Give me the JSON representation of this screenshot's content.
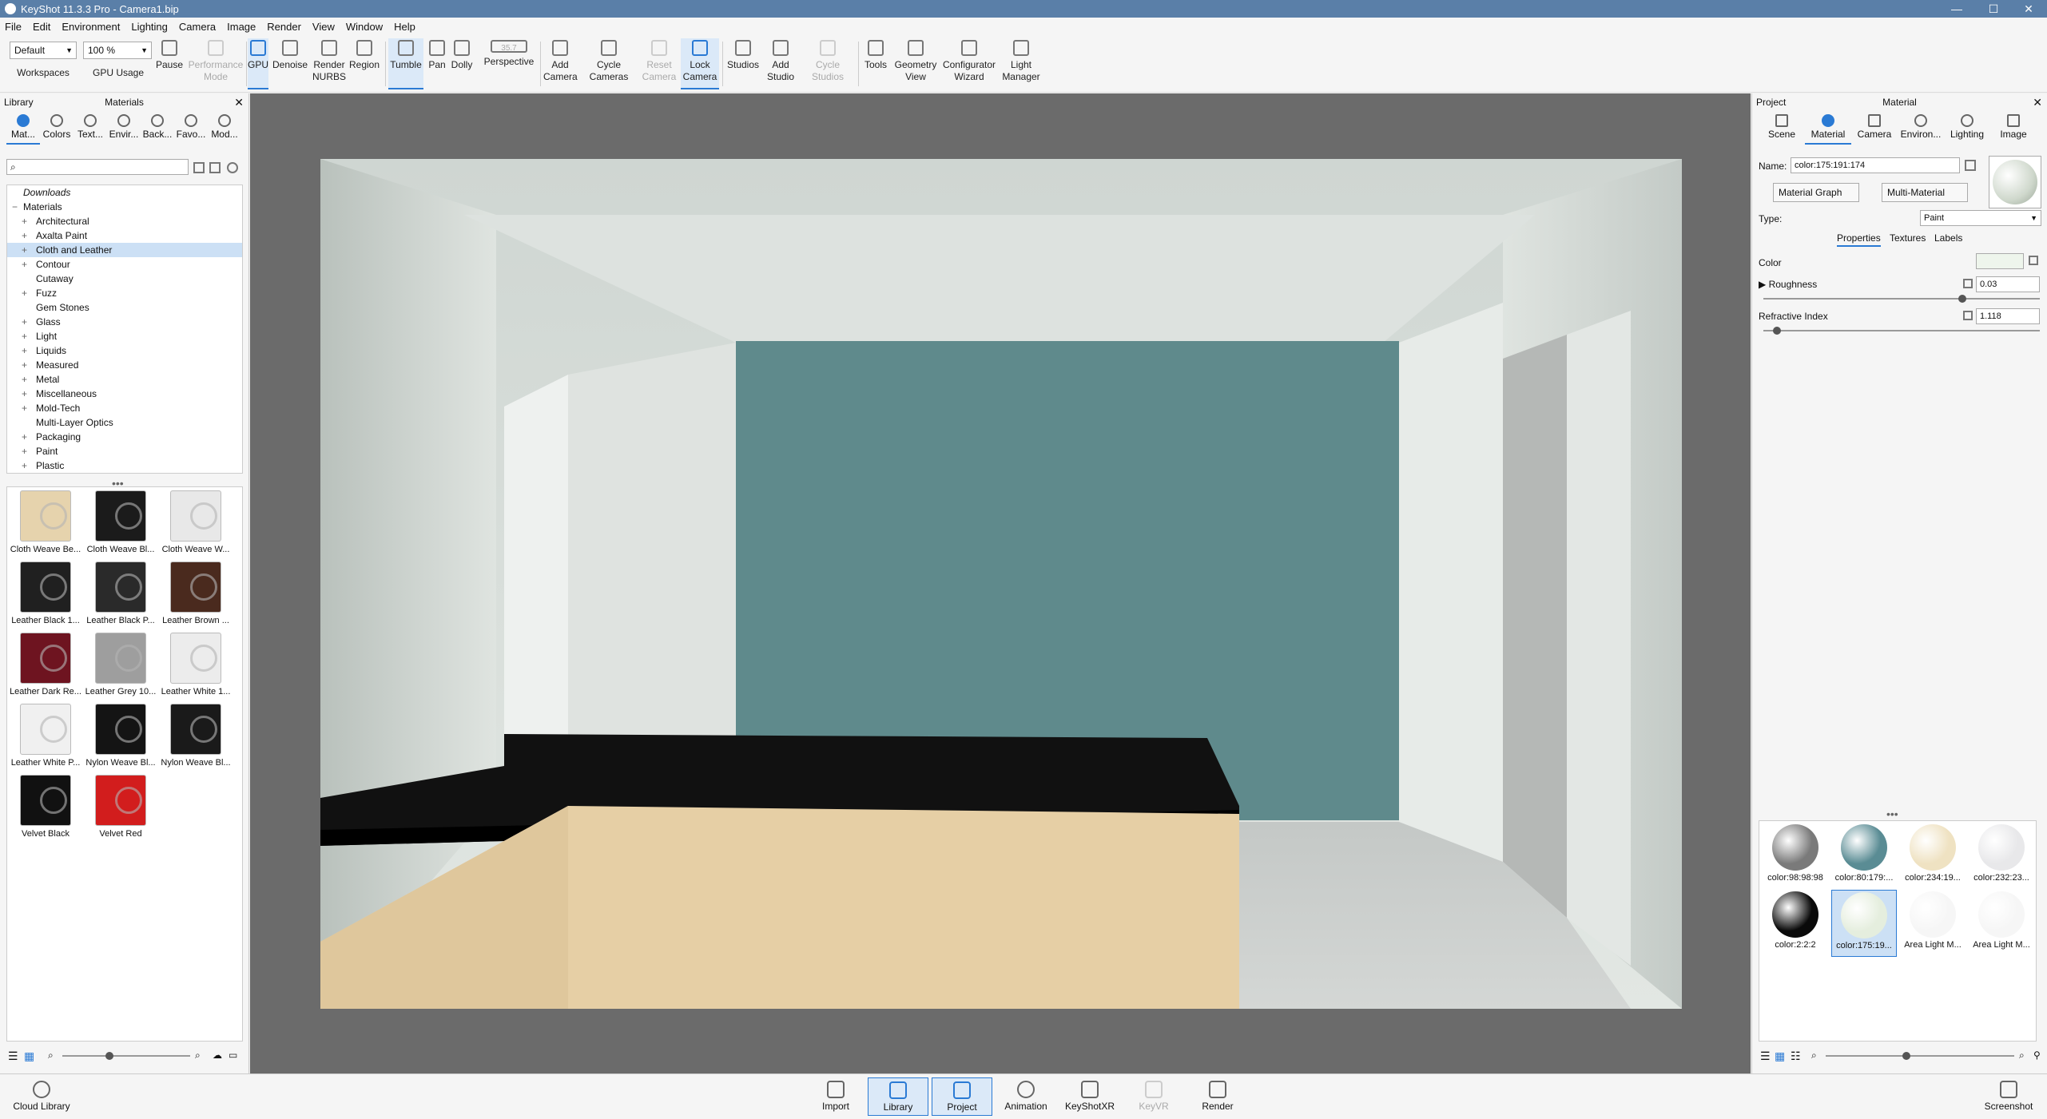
{
  "window": {
    "title": "KeyShot 11.3.3 Pro  - Camera1.bip",
    "min": "—",
    "max": "☐",
    "close": "✕"
  },
  "menu": [
    "File",
    "Edit",
    "Environment",
    "Lighting",
    "Camera",
    "Image",
    "Render",
    "View",
    "Window",
    "Help"
  ],
  "toolbar": {
    "workspace_select": "Default",
    "zoom_select": "100 %",
    "focal": "35.7",
    "workspaces": "Workspaces",
    "gpu_usage": "GPU Usage",
    "pause": "Pause",
    "performance_mode": "Performance Mode",
    "gpu": "GPU",
    "denoise": "Denoise",
    "render_nurbs": "Render NURBS",
    "region": "Region",
    "tumble": "Tumble",
    "pan": "Pan",
    "dolly": "Dolly",
    "perspective": "Perspective",
    "add_camera": "Add Camera",
    "cycle_cameras": "Cycle Cameras",
    "reset_camera": "Reset Camera",
    "lock_camera": "Lock Camera",
    "studios": "Studios",
    "add_studio": "Add Studio",
    "cycle_studios": "Cycle Studios",
    "tools": "Tools",
    "geometry_view": "Geometry View",
    "configurator_wizard": "Configurator Wizard",
    "light_manager": "Light Manager"
  },
  "library": {
    "header": "Library",
    "title": "Materials",
    "tabs": [
      "Mat...",
      "Colors",
      "Text...",
      "Envir...",
      "Back...",
      "Favo...",
      "Mod..."
    ],
    "tree": {
      "downloads": "Downloads",
      "root": "Materials",
      "items": [
        {
          "label": "Architectural",
          "expand": true
        },
        {
          "label": "Axalta Paint",
          "expand": true
        },
        {
          "label": "Cloth and Leather",
          "expand": true,
          "selected": true
        },
        {
          "label": "Contour",
          "expand": true
        },
        {
          "label": "Cutaway",
          "expand": false
        },
        {
          "label": "Fuzz",
          "expand": true
        },
        {
          "label": "Gem Stones",
          "expand": false
        },
        {
          "label": "Glass",
          "expand": true
        },
        {
          "label": "Light",
          "expand": true
        },
        {
          "label": "Liquids",
          "expand": true
        },
        {
          "label": "Measured",
          "expand": true
        },
        {
          "label": "Metal",
          "expand": true
        },
        {
          "label": "Miscellaneous",
          "expand": true
        },
        {
          "label": "Mold-Tech",
          "expand": true
        },
        {
          "label": "Multi-Layer Optics",
          "expand": false
        },
        {
          "label": "Packaging",
          "expand": true
        },
        {
          "label": "Paint",
          "expand": true
        },
        {
          "label": "Plastic",
          "expand": true
        }
      ]
    },
    "thumbnails": [
      {
        "label": "Cloth Weave Be...",
        "color": "#e6d3ad"
      },
      {
        "label": "Cloth Weave Bl...",
        "color": "#1b1b1b"
      },
      {
        "label": "Cloth Weave W...",
        "color": "#e8e8e8"
      },
      {
        "label": "Leather Black 1...",
        "color": "#202020"
      },
      {
        "label": "Leather Black P...",
        "color": "#2a2a2a"
      },
      {
        "label": "Leather Brown ...",
        "color": "#4a2a1e"
      },
      {
        "label": "Leather Dark Re...",
        "color": "#6e1420"
      },
      {
        "label": "Leather Grey 10...",
        "color": "#9e9e9e"
      },
      {
        "label": "Leather White 1...",
        "color": "#ececec"
      },
      {
        "label": "Leather White P...",
        "color": "#f0f0f0"
      },
      {
        "label": "Nylon Weave Bl...",
        "color": "#141414"
      },
      {
        "label": "Nylon Weave Bl...",
        "color": "#1a1a1a"
      },
      {
        "label": "Velvet Black",
        "color": "#111111"
      },
      {
        "label": "Velvet Red",
        "color": "#d21d1d"
      }
    ]
  },
  "project": {
    "header": "Project",
    "title": "Material",
    "tabs": [
      "Scene",
      "Material",
      "Camera",
      "Environ...",
      "Lighting",
      "Image"
    ],
    "name_label": "Name:",
    "name_value": "color:175:191:174",
    "material_graph": "Material Graph",
    "multi_material": "Multi-Material",
    "type_label": "Type:",
    "type_value": "Paint",
    "subtabs": [
      "Properties",
      "Textures",
      "Labels"
    ],
    "color_label": "Color",
    "color_value": "#eef5ec",
    "roughness_label": "Roughness",
    "roughness_value": "0.03",
    "refractive_label": "Refractive Index",
    "refractive_value": "1.118",
    "materials": [
      {
        "label": "color:98:98:98",
        "color": "#7a7a7a"
      },
      {
        "label": "color:80:179:...",
        "color": "#5a8c94"
      },
      {
        "label": "color:234:19...",
        "color": "#efe2c2"
      },
      {
        "label": "color:232:23...",
        "color": "#e8e8ea"
      },
      {
        "label": "color:2:2:2",
        "color": "#0a0a0a"
      },
      {
        "label": "color:175:19...",
        "color": "#e5eede",
        "selected": true
      },
      {
        "label": "Area Light M...",
        "color": "#f6f6f6"
      },
      {
        "label": "Area Light M...",
        "color": "#f6f6f6"
      }
    ]
  },
  "bottom": {
    "cloud_library": "Cloud Library",
    "import": "Import",
    "library": "Library",
    "project": "Project",
    "animation": "Animation",
    "keyshotxr": "KeyShotXR",
    "keyvr": "KeyVR",
    "render": "Render",
    "screenshot": "Screenshot"
  }
}
